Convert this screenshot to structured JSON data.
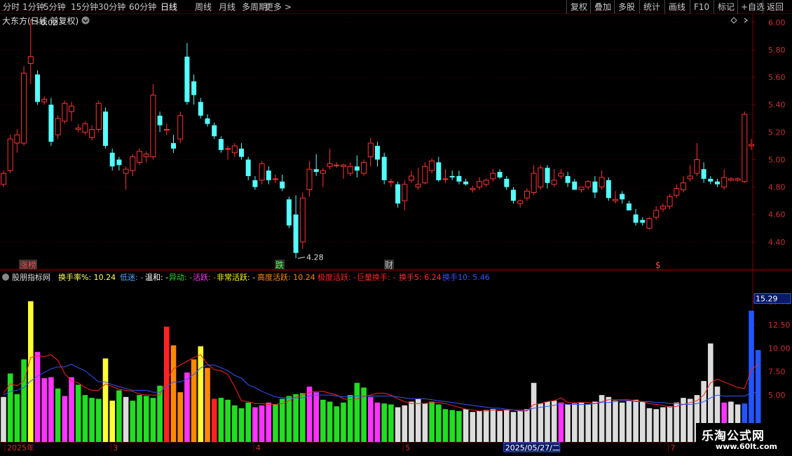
{
  "toolbar": {
    "items": [
      "分时",
      "1分钟",
      "5分钟",
      "15分钟",
      "30分钟",
      "60分钟",
      "日线",
      "周线",
      "月线",
      "多周期",
      "更多 >"
    ],
    "active_index": 6,
    "right_items": [
      "复权",
      "叠加",
      "多股",
      "统计",
      "画线",
      "F10",
      "标记",
      "+自选",
      "返回"
    ]
  },
  "stock": {
    "title": "大东方(日线 前复权)"
  },
  "price_axis": {
    "labels": [
      "6.00",
      "5.80",
      "5.60",
      "5.40",
      "5.20",
      "5.00",
      "4.80",
      "4.60",
      "4.40"
    ]
  },
  "price_marks": {
    "high_label": "6.02",
    "low_label": "4.28"
  },
  "event_tags": {
    "zhangbang": "涨榜",
    "die": "跌",
    "cai": "财",
    "dollar": "$"
  },
  "indicator": {
    "name": "股朋指标网",
    "labels": [
      {
        "text": "换手率%: 10.24",
        "color": "#ffff66"
      },
      {
        "text": "低迷: -",
        "color": "#4da6ff"
      },
      {
        "text": "温和: -",
        "color": "#ffffff"
      },
      {
        "text": "异动: -",
        "color": "#22dd22"
      },
      {
        "text": "活跃: -",
        "color": "#ff33ff"
      },
      {
        "text": "非常活跃: -",
        "color": "#ffff00"
      },
      {
        "text": "高度活跃: 10.24",
        "color": "#ff8800"
      },
      {
        "text": "极度活跃: -",
        "color": "#ff2222"
      },
      {
        "text": "巨量换手: -",
        "color": "#ff2222"
      },
      {
        "text": "换手5: 6.24",
        "color": "#ff3333"
      },
      {
        "text": "换手10: 5.46",
        "color": "#3355ff"
      }
    ],
    "current_value": "15.29",
    "axis_labels": [
      "15.00",
      "12.50",
      "10.00",
      "7.50",
      "5.00"
    ]
  },
  "date_axis": {
    "labels": [
      "2025年",
      "3",
      "4",
      "5",
      "2025/05/27/二",
      "7"
    ]
  },
  "watermark": {
    "name": "乐淘公式网",
    "url": "www.60lt.com"
  },
  "colors": {
    "up": "#ff3333",
    "down": "#54ffff",
    "grid": "#7a0000",
    "axis_text": "#c83232"
  },
  "chart_data": {
    "type": "candlestick",
    "title": "大东方(日线 前复权)",
    "ylim": [
      4.2,
      6.04
    ],
    "candles": [
      {
        "o": 4.82,
        "h": 4.92,
        "l": 4.8,
        "c": 4.9
      },
      {
        "o": 4.92,
        "h": 5.18,
        "l": 4.9,
        "c": 5.15
      },
      {
        "o": 5.12,
        "h": 5.22,
        "l": 5.05,
        "c": 5.18
      },
      {
        "o": 5.12,
        "h": 5.68,
        "l": 5.1,
        "c": 5.63
      },
      {
        "o": 5.7,
        "h": 6.02,
        "l": 5.55,
        "c": 5.75
      },
      {
        "o": 5.62,
        "h": 5.65,
        "l": 5.4,
        "c": 5.42
      },
      {
        "o": 5.42,
        "h": 5.46,
        "l": 5.4,
        "c": 5.44
      },
      {
        "o": 5.4,
        "h": 5.45,
        "l": 5.1,
        "c": 5.13
      },
      {
        "o": 5.18,
        "h": 5.32,
        "l": 5.15,
        "c": 5.3
      },
      {
        "o": 5.28,
        "h": 5.43,
        "l": 5.26,
        "c": 5.41
      },
      {
        "o": 5.35,
        "h": 5.42,
        "l": 5.28,
        "c": 5.39
      },
      {
        "o": 5.22,
        "h": 5.26,
        "l": 5.2,
        "c": 5.23
      },
      {
        "o": 5.2,
        "h": 5.28,
        "l": 5.18,
        "c": 5.26
      },
      {
        "o": 5.16,
        "h": 5.25,
        "l": 5.14,
        "c": 5.22
      },
      {
        "o": 5.22,
        "h": 5.43,
        "l": 5.2,
        "c": 5.41
      },
      {
        "o": 5.35,
        "h": 5.38,
        "l": 5.08,
        "c": 5.1
      },
      {
        "o": 5.05,
        "h": 5.08,
        "l": 4.92,
        "c": 4.95
      },
      {
        "o": 5.0,
        "h": 5.02,
        "l": 4.92,
        "c": 4.96
      },
      {
        "o": 4.9,
        "h": 4.95,
        "l": 4.78,
        "c": 4.93
      },
      {
        "o": 4.92,
        "h": 5.04,
        "l": 4.88,
        "c": 5.02
      },
      {
        "o": 4.98,
        "h": 5.08,
        "l": 4.96,
        "c": 5.06
      },
      {
        "o": 5.02,
        "h": 5.06,
        "l": 4.98,
        "c": 5.04
      },
      {
        "o": 5.02,
        "h": 5.55,
        "l": 5.0,
        "c": 5.47
      },
      {
        "o": 5.32,
        "h": 5.35,
        "l": 5.2,
        "c": 5.25
      },
      {
        "o": 5.22,
        "h": 5.26,
        "l": 5.18,
        "c": 5.22
      },
      {
        "o": 5.12,
        "h": 5.18,
        "l": 5.05,
        "c": 5.08
      },
      {
        "o": 5.15,
        "h": 5.35,
        "l": 5.12,
        "c": 5.32
      },
      {
        "o": 5.75,
        "h": 5.85,
        "l": 5.4,
        "c": 5.42
      },
      {
        "o": 5.57,
        "h": 5.62,
        "l": 5.4,
        "c": 5.47
      },
      {
        "o": 5.42,
        "h": 5.45,
        "l": 5.3,
        "c": 5.32
      },
      {
        "o": 5.3,
        "h": 5.33,
        "l": 5.24,
        "c": 5.26
      },
      {
        "o": 5.25,
        "h": 5.27,
        "l": 5.15,
        "c": 5.17
      },
      {
        "o": 5.15,
        "h": 5.17,
        "l": 5.05,
        "c": 5.07
      },
      {
        "o": 5.08,
        "h": 5.1,
        "l": 5.0,
        "c": 5.08
      },
      {
        "o": 5.05,
        "h": 5.12,
        "l": 5.02,
        "c": 5.1
      },
      {
        "o": 5.08,
        "h": 5.12,
        "l": 5.0,
        "c": 5.02
      },
      {
        "o": 5.0,
        "h": 5.02,
        "l": 4.85,
        "c": 4.88
      },
      {
        "o": 4.85,
        "h": 4.88,
        "l": 4.78,
        "c": 4.8
      },
      {
        "o": 4.85,
        "h": 4.99,
        "l": 4.82,
        "c": 4.97
      },
      {
        "o": 4.92,
        "h": 4.95,
        "l": 4.82,
        "c": 4.85
      },
      {
        "o": 4.86,
        "h": 4.89,
        "l": 4.83,
        "c": 4.86
      },
      {
        "o": 4.84,
        "h": 4.89,
        "l": 4.77,
        "c": 4.79
      },
      {
        "o": 4.71,
        "h": 4.73,
        "l": 4.5,
        "c": 4.52
      },
      {
        "o": 4.6,
        "h": 4.74,
        "l": 4.28,
        "c": 4.32
      },
      {
        "o": 4.4,
        "h": 4.76,
        "l": 4.35,
        "c": 4.72
      },
      {
        "o": 4.78,
        "h": 4.99,
        "l": 4.73,
        "c": 4.93
      },
      {
        "o": 4.93,
        "h": 5.04,
        "l": 4.88,
        "c": 4.91
      },
      {
        "o": 4.9,
        "h": 4.94,
        "l": 4.8,
        "c": 4.92
      },
      {
        "o": 4.95,
        "h": 5.08,
        "l": 4.93,
        "c": 4.97
      },
      {
        "o": 4.96,
        "h": 4.98,
        "l": 4.94,
        "c": 4.96
      },
      {
        "o": 4.95,
        "h": 4.97,
        "l": 4.86,
        "c": 4.96
      },
      {
        "o": 4.9,
        "h": 4.98,
        "l": 4.88,
        "c": 4.95
      },
      {
        "o": 4.95,
        "h": 5.03,
        "l": 4.87,
        "c": 4.92
      },
      {
        "o": 4.9,
        "h": 5.0,
        "l": 4.88,
        "c": 4.98
      },
      {
        "o": 5.02,
        "h": 5.16,
        "l": 4.95,
        "c": 5.12
      },
      {
        "o": 5.1,
        "h": 5.13,
        "l": 4.95,
        "c": 5.0
      },
      {
        "o": 5.02,
        "h": 5.05,
        "l": 4.82,
        "c": 4.85
      },
      {
        "o": 4.84,
        "h": 4.86,
        "l": 4.8,
        "c": 4.84
      },
      {
        "o": 4.82,
        "h": 4.84,
        "l": 4.65,
        "c": 4.68
      },
      {
        "o": 4.7,
        "h": 4.85,
        "l": 4.63,
        "c": 4.82
      },
      {
        "o": 4.85,
        "h": 4.92,
        "l": 4.83,
        "c": 4.88
      },
      {
        "o": 4.8,
        "h": 4.94,
        "l": 4.78,
        "c": 4.82
      },
      {
        "o": 4.83,
        "h": 4.98,
        "l": 4.82,
        "c": 4.95
      },
      {
        "o": 4.92,
        "h": 5.01,
        "l": 4.9,
        "c": 4.99
      },
      {
        "o": 4.98,
        "h": 5.02,
        "l": 4.84,
        "c": 4.85
      },
      {
        "o": 4.86,
        "h": 4.93,
        "l": 4.83,
        "c": 4.86
      },
      {
        "o": 4.88,
        "h": 4.92,
        "l": 4.85,
        "c": 4.87
      },
      {
        "o": 4.88,
        "h": 4.92,
        "l": 4.82,
        "c": 4.84
      },
      {
        "o": 4.84,
        "h": 4.86,
        "l": 4.81,
        "c": 4.82
      },
      {
        "o": 4.78,
        "h": 4.81,
        "l": 4.76,
        "c": 4.79
      },
      {
        "o": 4.8,
        "h": 4.87,
        "l": 4.78,
        "c": 4.84
      },
      {
        "o": 4.82,
        "h": 4.86,
        "l": 4.8,
        "c": 4.85
      },
      {
        "o": 4.86,
        "h": 4.93,
        "l": 4.84,
        "c": 4.9
      },
      {
        "o": 4.91,
        "h": 4.93,
        "l": 4.86,
        "c": 4.87
      },
      {
        "o": 4.86,
        "h": 4.88,
        "l": 4.78,
        "c": 4.8
      },
      {
        "o": 4.78,
        "h": 4.8,
        "l": 4.68,
        "c": 4.7
      },
      {
        "o": 4.68,
        "h": 4.71,
        "l": 4.65,
        "c": 4.7
      },
      {
        "o": 4.72,
        "h": 4.79,
        "l": 4.7,
        "c": 4.77
      },
      {
        "o": 4.76,
        "h": 4.96,
        "l": 4.74,
        "c": 4.9
      },
      {
        "o": 4.8,
        "h": 4.96,
        "l": 4.78,
        "c": 4.94
      },
      {
        "o": 4.94,
        "h": 4.96,
        "l": 4.79,
        "c": 4.83
      },
      {
        "o": 4.82,
        "h": 4.93,
        "l": 4.8,
        "c": 4.85
      },
      {
        "o": 4.88,
        "h": 4.93,
        "l": 4.86,
        "c": 4.9
      },
      {
        "o": 4.88,
        "h": 4.91,
        "l": 4.8,
        "c": 4.83
      },
      {
        "o": 4.84,
        "h": 4.86,
        "l": 4.8,
        "c": 4.78
      },
      {
        "o": 4.78,
        "h": 4.8,
        "l": 4.76,
        "c": 4.8
      },
      {
        "o": 4.8,
        "h": 4.85,
        "l": 4.78,
        "c": 4.84
      },
      {
        "o": 4.84,
        "h": 4.88,
        "l": 4.72,
        "c": 4.76
      },
      {
        "o": 4.8,
        "h": 4.92,
        "l": 4.78,
        "c": 4.87
      },
      {
        "o": 4.85,
        "h": 4.87,
        "l": 4.7,
        "c": 4.72
      },
      {
        "o": 4.7,
        "h": 4.77,
        "l": 4.68,
        "c": 4.71
      },
      {
        "o": 4.75,
        "h": 4.77,
        "l": 4.68,
        "c": 4.71
      },
      {
        "o": 4.68,
        "h": 4.7,
        "l": 4.64,
        "c": 4.63
      },
      {
        "o": 4.6,
        "h": 4.64,
        "l": 4.52,
        "c": 4.54
      },
      {
        "o": 4.56,
        "h": 4.58,
        "l": 4.52,
        "c": 4.54
      },
      {
        "o": 4.5,
        "h": 4.58,
        "l": 4.49,
        "c": 4.57
      },
      {
        "o": 4.58,
        "h": 4.66,
        "l": 4.56,
        "c": 4.63
      },
      {
        "o": 4.64,
        "h": 4.68,
        "l": 4.62,
        "c": 4.66
      },
      {
        "o": 4.66,
        "h": 4.75,
        "l": 4.64,
        "c": 4.73
      },
      {
        "o": 4.74,
        "h": 4.82,
        "l": 4.72,
        "c": 4.79
      },
      {
        "o": 4.78,
        "h": 4.88,
        "l": 4.76,
        "c": 4.83
      },
      {
        "o": 4.86,
        "h": 4.96,
        "l": 4.84,
        "c": 4.88
      },
      {
        "o": 4.9,
        "h": 5.12,
        "l": 4.88,
        "c": 5.0
      },
      {
        "o": 4.93,
        "h": 4.98,
        "l": 4.83,
        "c": 4.86
      },
      {
        "o": 4.86,
        "h": 4.88,
        "l": 4.82,
        "c": 4.84
      },
      {
        "o": 4.84,
        "h": 4.86,
        "l": 4.8,
        "c": 4.82
      },
      {
        "o": 4.8,
        "h": 4.93,
        "l": 4.78,
        "c": 4.87
      },
      {
        "o": 4.85,
        "h": 4.87,
        "l": 4.84,
        "c": 4.86
      },
      {
        "o": 4.85,
        "h": 4.87,
        "l": 4.84,
        "c": 4.86
      },
      {
        "o": 4.84,
        "h": 5.35,
        "l": 4.83,
        "c": 5.33
      },
      {
        "o": 5.1,
        "h": 5.15,
        "l": 5.07,
        "c": 5.11
      }
    ],
    "turnover_ylim": [
      0,
      16.6
    ],
    "turnover": [
      4.8,
      7.3,
      5.1,
      8.8,
      15.0,
      9.6,
      6.8,
      6.9,
      5.7,
      4.9,
      6.9,
      6.1,
      5.0,
      4.7,
      4.6,
      8.9,
      4.4,
      5.5,
      4.8,
      4.4,
      5.0,
      4.9,
      4.7,
      6.0,
      12.3,
      10.3,
      5.3,
      7.4,
      8.8,
      10.2,
      7.9,
      4.6,
      4.7,
      4.5,
      3.9,
      3.6,
      4.2,
      3.7,
      3.9,
      4.2,
      4.0,
      4.6,
      4.9,
      5.1,
      5.2,
      5.9,
      5.3,
      4.5,
      4.3,
      3.8,
      4.2,
      5.0,
      6.3,
      5.8,
      4.8,
      4.2,
      4.1,
      4.0,
      3.7,
      3.9,
      4.3,
      4.6,
      4.1,
      4.3,
      4.0,
      3.5,
      3.4,
      3.3,
      3.5,
      3.2,
      3.3,
      3.4,
      3.5,
      3.3,
      3.4,
      3.2,
      3.3,
      3.5,
      6.3,
      4.1,
      4.3,
      4.4,
      4.2,
      4.0,
      4.1,
      4.2,
      4.0,
      4.3,
      5.0,
      4.8,
      4.4,
      4.2,
      4.4,
      4.5,
      4.3,
      3.6,
      3.5,
      3.7,
      3.8,
      4.2,
      4.7,
      4.6,
      5.0,
      6.5,
      10.5,
      5.9,
      4.2,
      4.3,
      4.0,
      4.1,
      14.0,
      9.8
    ],
    "turnover_color_codes": "lgggymmmgmmggggyyglgggggrooaoyorgggggmmmgggggmmgggggggmmgglllllgggggllllllllllllllmlllllllllllllllllllllllmllbbbllggooollloo",
    "turnover_color_legend": {
      "g": "#22dd22",
      "m": "#ff33ff",
      "y": "#ffff33",
      "r": "#ff2222",
      "o": "#ff8800",
      "l": "#dcdcdc",
      "b": "#2255ff",
      "a": "#ff33ff"
    },
    "turnover_ma5": [
      5.2,
      6.2,
      6.0,
      6.5,
      9.0,
      9.2,
      9.1,
      9.3,
      8.7,
      7.3,
      6.5,
      6.3,
      5.8,
      5.5,
      5.5,
      6.2,
      5.9,
      5.6,
      5.5,
      5.4,
      5.1,
      5.0,
      5.0,
      5.0,
      6.6,
      7.8,
      8.2,
      8.6,
      9.0,
      9.3,
      8.3,
      7.7,
      7.6,
      7.2,
      5.9,
      4.4,
      4.3,
      4.1,
      4.1,
      4.0,
      4.0,
      4.1,
      4.4,
      4.8,
      5.0,
      5.3,
      5.4,
      5.4,
      5.2,
      5.0,
      4.6,
      4.5,
      4.6,
      4.8,
      5.0,
      5.2,
      5.2,
      5.0,
      4.6,
      4.3,
      4.1,
      4.1,
      4.1,
      4.2,
      4.2,
      4.1,
      3.9,
      3.7,
      3.5,
      3.4,
      3.3,
      3.3,
      3.4,
      3.4,
      3.4,
      3.4,
      3.3,
      3.3,
      4.0,
      4.1,
      4.3,
      4.4,
      4.7,
      4.2,
      4.2,
      4.2,
      4.2,
      4.1,
      4.3,
      4.5,
      4.5,
      4.5,
      4.5,
      4.4,
      4.3,
      4.1,
      4.0,
      3.9,
      3.7,
      3.8,
      4.0,
      4.2,
      4.4,
      5.0,
      6.3,
      6.7,
      6.4,
      6.1,
      5.8,
      5.7,
      7.7,
      8.3
    ],
    "turnover_ma10": [
      5.0,
      5.4,
      5.5,
      5.8,
      6.5,
      7.0,
      7.4,
      7.8,
      8.0,
      8.0,
      8.3,
      7.9,
      7.6,
      7.0,
      6.4,
      6.4,
      6.1,
      5.9,
      5.7,
      5.5,
      5.5,
      5.5,
      5.3,
      5.3,
      5.9,
      6.4,
      6.4,
      6.7,
      7.2,
      7.9,
      8.2,
      8.2,
      7.9,
      7.6,
      7.1,
      6.8,
      6.1,
      5.8,
      5.4,
      5.1,
      4.8,
      4.7,
      4.7,
      4.7,
      4.7,
      4.9,
      5.0,
      5.0,
      5.0,
      4.9,
      4.8,
      4.8,
      4.9,
      4.9,
      4.9,
      4.9,
      4.9,
      4.9,
      4.8,
      4.7,
      4.6,
      4.6,
      4.6,
      4.5,
      4.4,
      4.3,
      4.2,
      4.1,
      4.0,
      3.9,
      3.8,
      3.7,
      3.6,
      3.6,
      3.5,
      3.4,
      3.4,
      3.4,
      3.6,
      3.7,
      3.8,
      3.9,
      4.1,
      4.0,
      4.0,
      4.0,
      4.0,
      4.1,
      4.2,
      4.2,
      4.3,
      4.4,
      4.4,
      4.3,
      4.3,
      4.3,
      4.2,
      4.2,
      4.1,
      4.1,
      4.0,
      4.0,
      4.1,
      4.3,
      4.7,
      5.0,
      4.9,
      4.9,
      4.9,
      4.9,
      5.2,
      5.3
    ]
  }
}
